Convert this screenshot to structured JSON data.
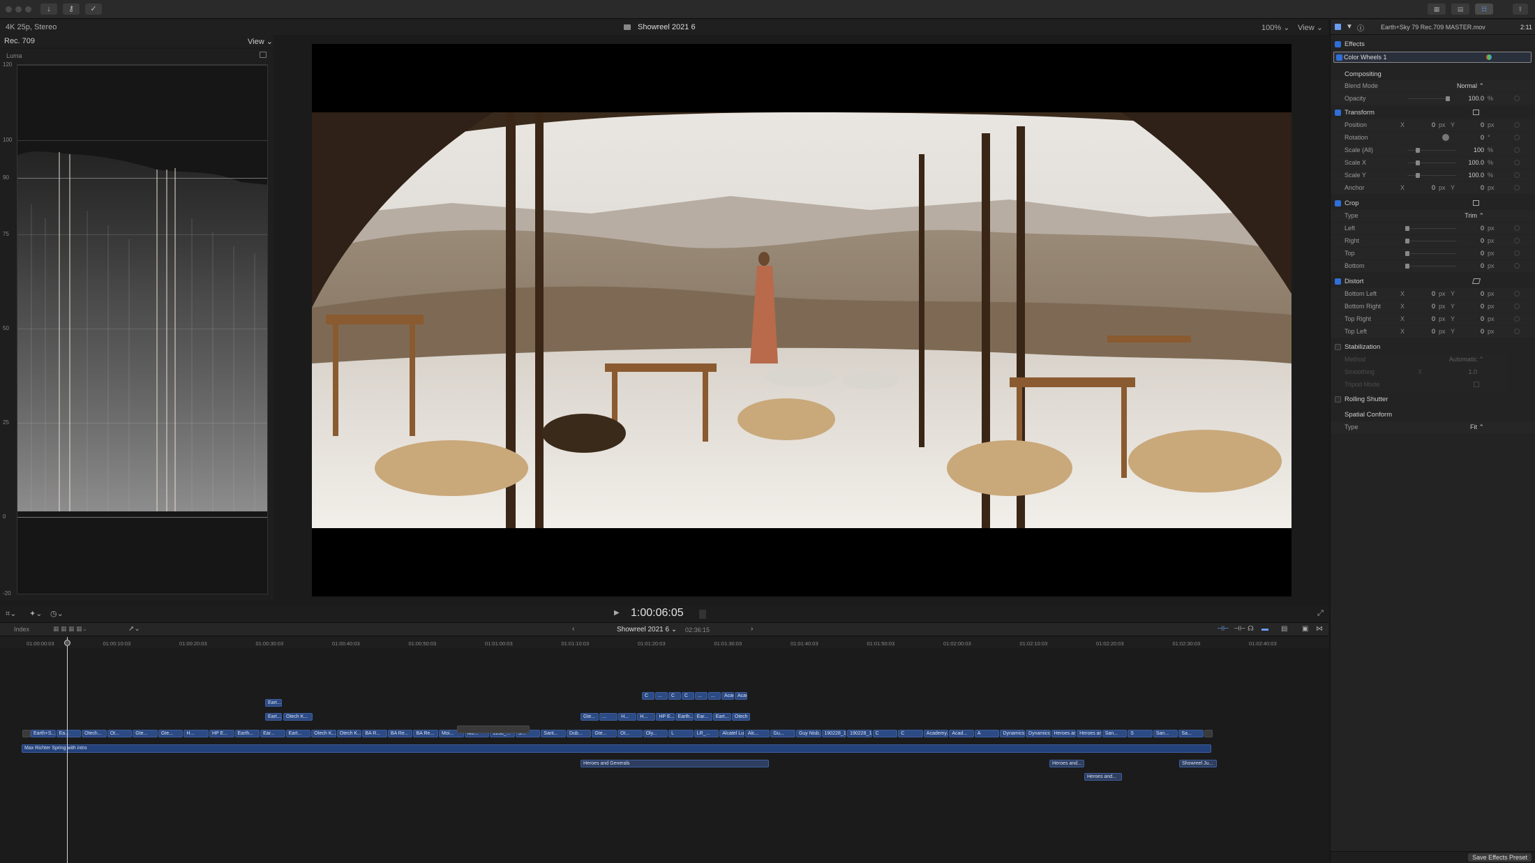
{
  "topbar": {
    "buttons": [
      "↓",
      "⚷",
      "✓"
    ],
    "right_buttons": [
      "▦",
      "▤",
      "☷"
    ],
    "share": "⇪"
  },
  "viewer_bar": {
    "format": "4K 25p, Stereo",
    "title": "Showreel 2021 6",
    "zoom": "100%",
    "view": "View"
  },
  "scope": {
    "standard": "Rec. 709",
    "view": "View",
    "mode": "Luma",
    "labels": [
      "120",
      "100",
      "90",
      "75",
      "50",
      "25",
      "0",
      "-20"
    ]
  },
  "inspector": {
    "clip_name": "Earth+Sky 79 Rec.709 MASTER.mov",
    "duration": "2:11",
    "effects": "Effects",
    "effect_item": "Color Wheels 1",
    "compositing": "Compositing",
    "blend_mode_label": "Blend Mode",
    "blend_mode_value": "Normal",
    "opacity_label": "Opacity",
    "opacity_value": "100.0",
    "opacity_unit": "%",
    "transform": "Transform",
    "position_label": "Position",
    "rotation_label": "Rotation",
    "scale_all_label": "Scale (All)",
    "scale_x_label": "Scale X",
    "scale_y_label": "Scale Y",
    "anchor_label": "Anchor",
    "zero": "0",
    "px": "px",
    "deg": "°",
    "x": "X",
    "y": "Y",
    "pct": "%",
    "scale_all_value": "100",
    "scale_value": "100.0",
    "crop": "Crop",
    "type_label": "Type",
    "crop_type": "Trim",
    "left": "Left",
    "right": "Right",
    "top": "Top",
    "bottom": "Bottom",
    "distort": "Distort",
    "bottom_left": "Bottom Left",
    "bottom_right": "Bottom Right",
    "top_right": "Top Right",
    "top_left": "Top Left",
    "stabilization": "Stabilization",
    "method_label": "Method",
    "method_value": "Automatic",
    "smoothing_label": "Smoothing",
    "smoothing_value": "1.0",
    "tripod_label": "Tripod Mode",
    "rolling_shutter": "Rolling Shutter",
    "spatial_conform": "Spatial Conform",
    "conform_type": "Fit",
    "save_preset": "Save Effects Preset"
  },
  "transport": {
    "timecode": "1:00:06:05"
  },
  "timeline_header": {
    "index": "Index",
    "project": "Showreel 2021 6",
    "duration": "02:36:15"
  },
  "ruler": [
    "01:00:00:03",
    "01:00:10:03",
    "01:00:20:03",
    "01:00:30:03",
    "01:00:40:03",
    "01:00:50:03",
    "01:01:00:03",
    "01:01:10:03",
    "01:01:20:03",
    "01:01:30:03",
    "01:01:40:03",
    "01:01:50:03",
    "01:02:00:03",
    "01:02:10:03",
    "01:02:20:03",
    "01:02:30:03",
    "01:02:40:03"
  ],
  "clips": {
    "primary": [
      "Earth+S...",
      "Ea...",
      "Otech...",
      "Ot...",
      "Gte...",
      "Gte...",
      "H...",
      "HP E...",
      "Earth...",
      "Ear...",
      "Eart...",
      "Otech K...",
      "Otech K...",
      "BA R...",
      "BA Re...",
      "BA Re...",
      "Moi...",
      "Mo...",
      "1238_...",
      "S...",
      "Sant...",
      "Dub...",
      "Gte...",
      "Ot...",
      "Oly...",
      "L",
      "LR_...",
      "Alcatel Lu...",
      "Alc...",
      "Gu...",
      "Guy Nisb...",
      "190228_1...",
      "190228_184...",
      "C",
      "C",
      "Academy...",
      "Acad...",
      "A",
      "Dynamics...",
      "Dynamics...",
      "Heroes and...",
      "Heroes and...",
      "San...",
      "S",
      "San...",
      "Sa..."
    ],
    "connected_top": [
      "C",
      "...",
      "C",
      "C",
      "...",
      "...",
      "Academy...",
      "Acad..."
    ],
    "connected_mid": [
      "Gte...",
      "...",
      "H...",
      "H...",
      "HP E...",
      "Earth...",
      "Ear...",
      "Eart...",
      "Otech K..."
    ],
    "connected_early": [
      "Eart...",
      "Eart...",
      "Otech K..."
    ],
    "music": "Max Richter Spring with intro",
    "below": [
      "Heroes and Generals",
      "Heroes and...",
      "Heroes and...",
      "Showreel Ju..."
    ]
  }
}
